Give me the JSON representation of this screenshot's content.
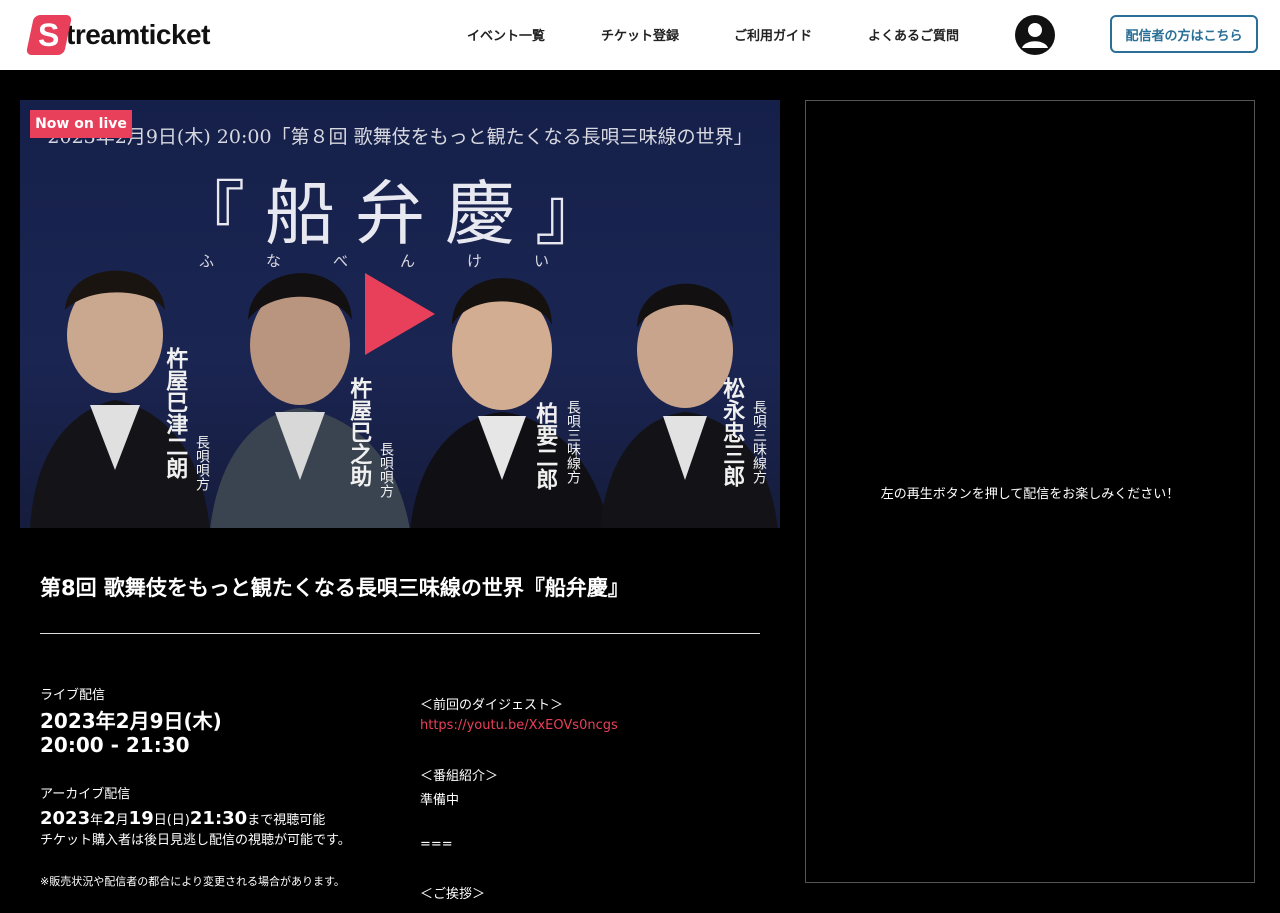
{
  "header": {
    "logo_letter": "S",
    "logo_text": "treamticket",
    "nav": [
      "イベント一覧",
      "チケット登録",
      "ご利用ガイド",
      "よくあるご質問"
    ],
    "streamer_button": "配信者の方はこちら"
  },
  "video": {
    "badge": "Now on live",
    "banner_line": "2023年2月9日(木) 20:00「第８回 歌舞伎をもっと観たくなる長唄三味線の世界」",
    "main_title": "『船弁慶』",
    "ruby": "ふなべんけい",
    "performers": [
      {
        "name": "杵屋巳津二朗",
        "role": "長唄唄方"
      },
      {
        "name": "杵屋巳之助",
        "role": "長唄唄方"
      },
      {
        "name": "柏要二郎",
        "role": "長唄三味線方"
      },
      {
        "name": "松永忠三郎",
        "role": "長唄三味線方"
      }
    ]
  },
  "chat": {
    "message": "左の再生ボタンを押して配信をお楽しみください！"
  },
  "event": {
    "title": "第8回 歌舞伎をもっと観たくなる長唄三味線の世界『船弁慶』",
    "live_label": "ライブ配信",
    "live_date": "2023年2月9日(木)",
    "live_time": "20:00 - 21:30",
    "archive_label": "アーカイブ配信",
    "archive_year": "2023",
    "archive_y_suffix": "年",
    "archive_month": "2",
    "archive_m_suffix": "月",
    "archive_day": "19",
    "archive_d_suffix": "日(日)",
    "archive_time": "21:30",
    "archive_tail": "まで視聴可能",
    "archive_note": "チケット購入者は後日見逃し配信の視聴が可能です。",
    "archive_note_small": "※販売状況や配信者の都合により変更される場合があります。"
  },
  "description": {
    "digest_heading": "＜前回のダイジェスト＞",
    "digest_link": "https://youtu.be/XxEOVs0ncgs",
    "intro_heading": "＜番組紹介＞",
    "intro_body": "準備中",
    "separator": "===",
    "greeting_heading": "＜ご挨拶＞"
  }
}
